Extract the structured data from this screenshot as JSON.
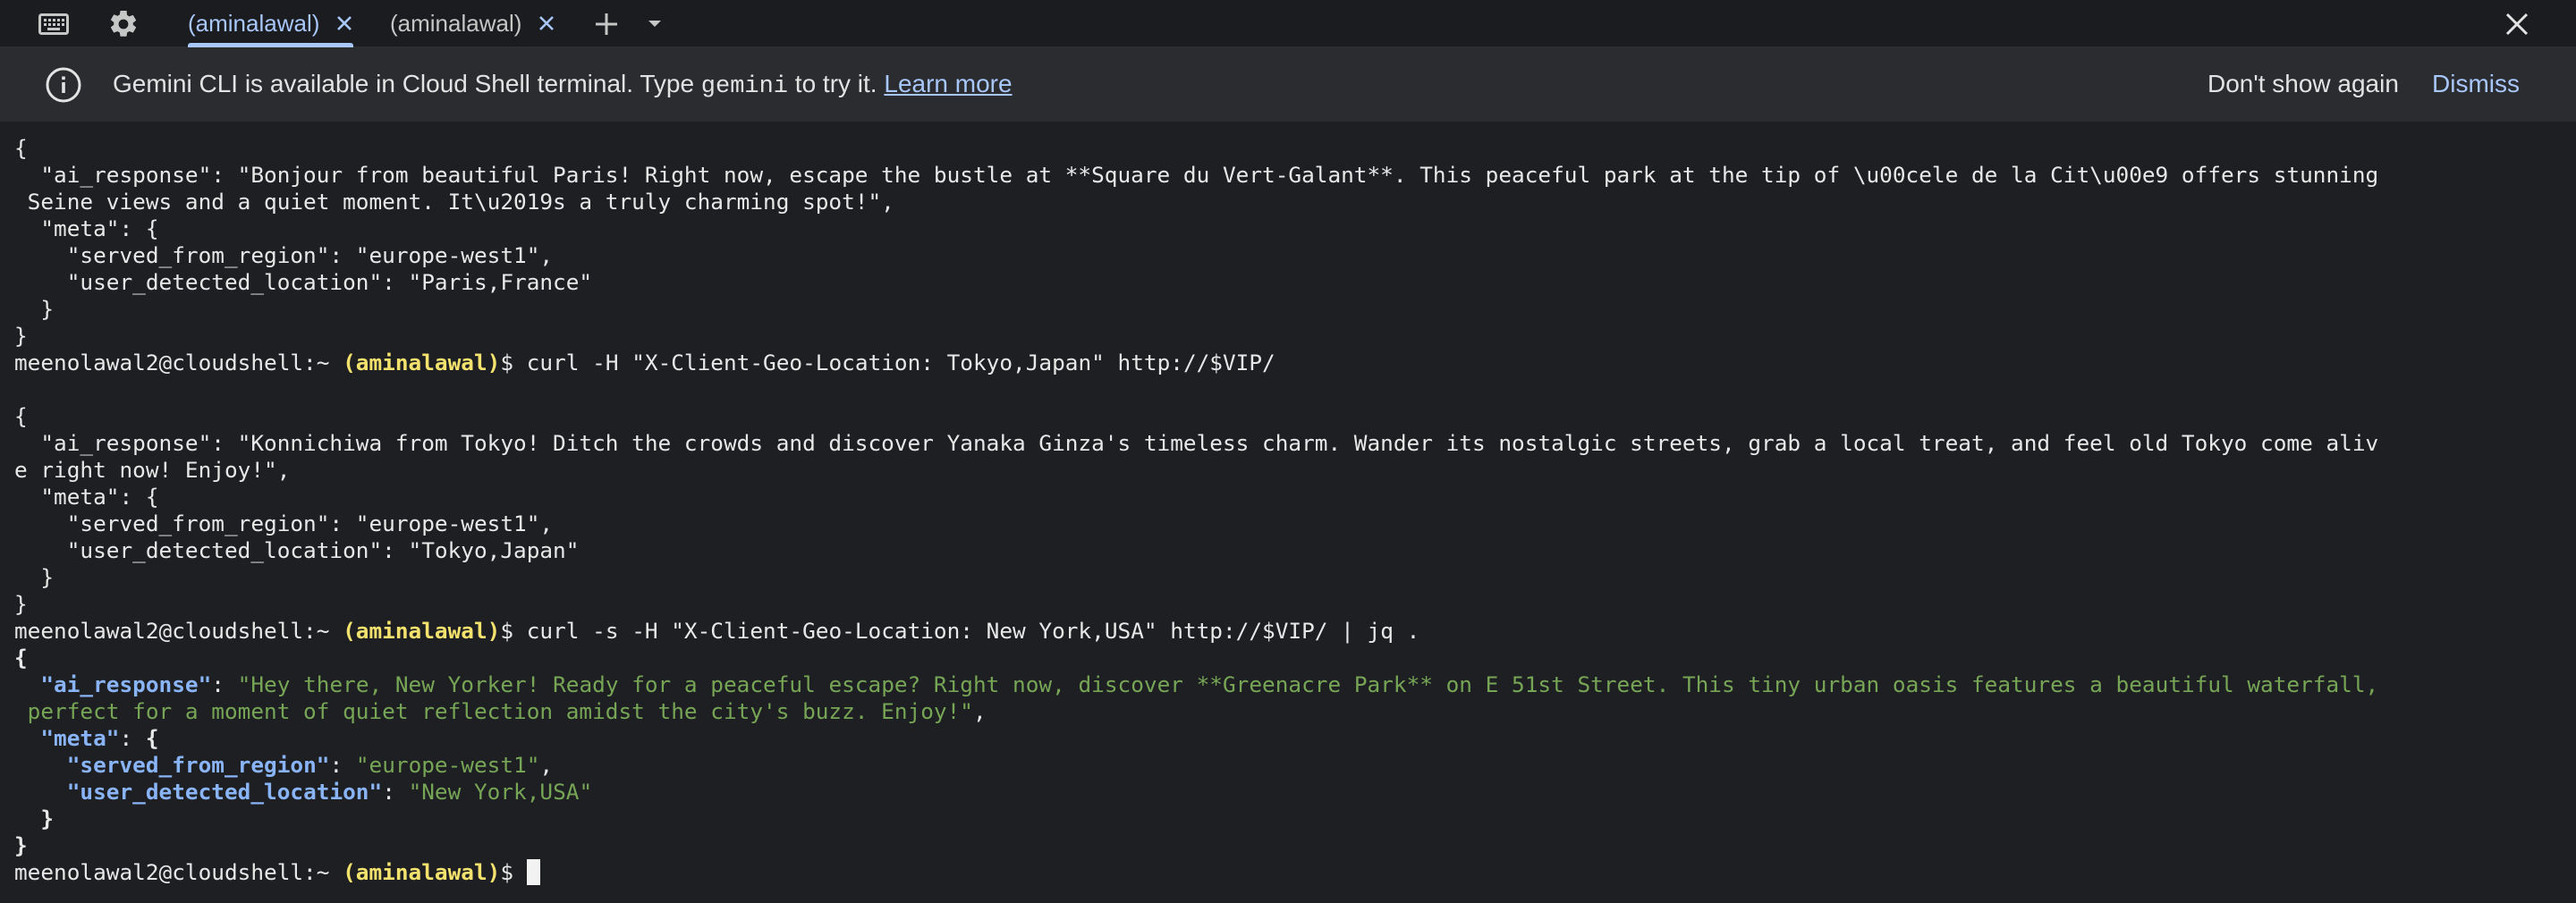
{
  "tabs": [
    {
      "label": "(aminalawal)",
      "active": true
    },
    {
      "label": "(aminalawal)",
      "active": false
    }
  ],
  "icons": {
    "keyboard": "keyboard-icon",
    "settings": "gear-icon",
    "close_tab": "close-icon",
    "new_tab": "plus-icon",
    "tab_menu": "chevron-down-icon",
    "close_window": "close-icon",
    "info": "info-icon"
  },
  "banner": {
    "text_before": "Gemini CLI is available in Cloud Shell terminal. Type ",
    "code": "gemini",
    "text_after": " to try it. ",
    "link": "Learn more",
    "dont_show": "Don't show again",
    "dismiss": "Dismiss"
  },
  "prompt": {
    "host": "meenolawal2@cloudshell:~ ",
    "user": "(aminalawal)",
    "dollar": "$ "
  },
  "terminal": {
    "block1": {
      "open": "{",
      "ai_1": "  \"ai_response\": \"Bonjour from beautiful Paris! Right now, escape the bustle at **Square du Vert-Galant**. This peaceful park at the tip of \\u00cele de la Cit\\u00e9 offers stunning",
      "ai_2": " Seine views and a quiet moment. It\\u2019s a truly charming spot!\",",
      "meta_open": "  \"meta\": {",
      "region": "    \"served_from_region\": \"europe-west1\",",
      "location": "    \"user_detected_location\": \"Paris,France\"",
      "meta_close": "  }",
      "close": "}"
    },
    "cmd1": "curl -H \"X-Client-Geo-Location: Tokyo,Japan\" http://$VIP/",
    "block2": {
      "open": "{",
      "ai_1": "  \"ai_response\": \"Konnichiwa from Tokyo! Ditch the crowds and discover Yanaka Ginza's timeless charm. Wander its nostalgic streets, grab a local treat, and feel old Tokyo come aliv",
      "ai_2": "e right now! Enjoy!\",",
      "meta_open": "  \"meta\": {",
      "region": "    \"served_from_region\": \"europe-west1\",",
      "location": "    \"user_detected_location\": \"Tokyo,Japan\"",
      "meta_close": "  }",
      "close": "}"
    },
    "cmd2": "curl -s -H \"X-Client-Geo-Location: New York,USA\" http://$VIP/ | jq .",
    "block3": {
      "open": "{",
      "indent2": "  ",
      "indent4": "    ",
      "ai_key": "\"ai_response\"",
      "sep": ": ",
      "ai_val_1": "\"Hey there, New Yorker! Ready for a peaceful escape? Right now, discover **Greenacre Park** on E 51st Street. This tiny urban oasis features a beautiful waterfall,",
      "ai_val_2": " perfect for a moment of quiet reflection amidst the city's buzz. Enjoy!\"",
      "comma": ",",
      "meta_key": "\"meta\"",
      "brace_open": "{",
      "region_key": "\"served_from_region\"",
      "region_val": "\"europe-west1\"",
      "location_key": "\"user_detected_location\"",
      "location_val": "\"New York,USA\"",
      "meta_close": "  }",
      "close": "}"
    }
  }
}
